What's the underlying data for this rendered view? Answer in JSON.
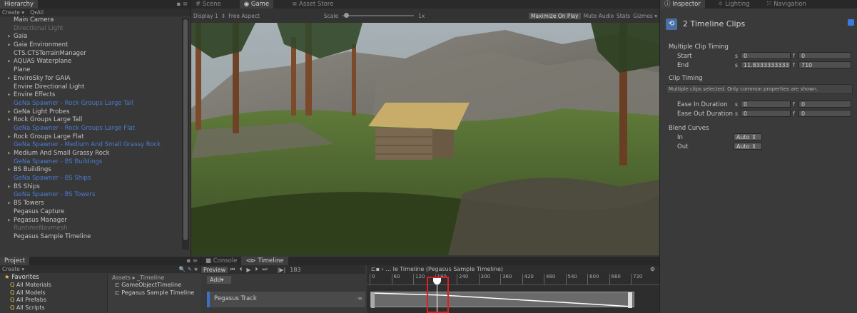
{
  "hierarchy": {
    "tab": "Hierarchy",
    "create": "Create ▾",
    "search": "Q▾All",
    "items": [
      {
        "label": "Main Camera",
        "style": ""
      },
      {
        "label": "Directional Light",
        "style": "disabled"
      },
      {
        "label": "Gaia",
        "style": "arrow"
      },
      {
        "label": "Gaia Environment",
        "style": "arrow"
      },
      {
        "label": "CTS.CTSTerrainManager",
        "style": ""
      },
      {
        "label": "AQUAS Waterplane",
        "style": "arrow"
      },
      {
        "label": "Plane",
        "style": ""
      },
      {
        "label": "EnviroSky for GAIA",
        "style": "arrow"
      },
      {
        "label": "Envire Directional Light",
        "style": ""
      },
      {
        "label": "Envire Effects",
        "style": "arrow"
      },
      {
        "label": "GeNa Spawner - Rock Groups Large Tall",
        "style": "blue"
      },
      {
        "label": "GeNa Light Probes",
        "style": "arrow"
      },
      {
        "label": "Rock Groups Large Tall",
        "style": "arrow"
      },
      {
        "label": "GeNa Spawner - Rock Groups Large Flat",
        "style": "blue"
      },
      {
        "label": "Rock Groups Large Flat",
        "style": "arrow"
      },
      {
        "label": "GeNa Spawner - Medium And Small Grassy Rock",
        "style": "blue"
      },
      {
        "label": "Medium And Small Grassy Rock",
        "style": "arrow"
      },
      {
        "label": "GeNa Spawner - BS Buildings",
        "style": "blue"
      },
      {
        "label": "BS Buildings",
        "style": "arrow"
      },
      {
        "label": "GeNa Spawner - BS Ships",
        "style": "blue"
      },
      {
        "label": "BS Ships",
        "style": "arrow"
      },
      {
        "label": "GeNa Spawner - BS Towers",
        "style": "blue"
      },
      {
        "label": "BS Towers",
        "style": "arrow"
      },
      {
        "label": "Pegasus Capture",
        "style": ""
      },
      {
        "label": "Pegasus Manager",
        "style": "arrow"
      },
      {
        "label": "RuntimeNavmesh",
        "style": "disabled"
      },
      {
        "label": "Pegasus Sample Timeline",
        "style": ""
      }
    ]
  },
  "scene": {
    "tabs": [
      "# Scene",
      "Game",
      "Asset Store"
    ],
    "display": "Display 1",
    "aspect": "Free Aspect",
    "scale_label": "Scale",
    "scale_value": "1x",
    "maximize": "Maximize On Play",
    "mute": "Mute Audio",
    "stats": "Stats",
    "gizmos": "Gizmos ▾"
  },
  "inspector": {
    "tabs": [
      "Inspector",
      "Lighting",
      "Navigation"
    ],
    "title": "2 Timeline Clips",
    "multiple_clip_timing": "Multiple Clip Timing",
    "start_label": "Start",
    "start_s": "0",
    "start_f": "0",
    "end_label": "End",
    "end_s": "11.8333333333",
    "end_f": "710",
    "clip_timing": "Clip Timing",
    "note": "Multiple clips selected. Only common properties are shown.",
    "ease_in": "Ease In Duration",
    "ease_in_s": "0",
    "ease_in_f": "0",
    "ease_out": "Ease Out Duration",
    "ease_out_s": "0",
    "ease_out_f": "0",
    "blend_curves": "Blend Curves",
    "in_label": "In",
    "in_value": "Auto",
    "out_label": "Out",
    "out_value": "Auto",
    "s_prefix": "s",
    "f_prefix": "f"
  },
  "project": {
    "tab": "Project",
    "create": "Create ▾",
    "favorites": "Favorites",
    "fav_items": [
      "All Materials",
      "All Models",
      "All Prefabs",
      "All Scripts"
    ],
    "breadcrumb": "Assets ▸ _Timeline",
    "files": [
      "GameObjectTimeline",
      "Pegasus Sample Timeline"
    ]
  },
  "timeline": {
    "tabs": [
      "Console",
      "Timeline"
    ],
    "preview": "Preview",
    "frame": "183",
    "title": "... le Timeline (Pegasus Sample Timeline)",
    "add": "Add▾",
    "track": "Pegasus Track",
    "ticks": [
      "0",
      "60",
      "120",
      "180",
      "240",
      "300",
      "360",
      "420",
      "480",
      "540",
      "600",
      "660",
      "720"
    ]
  },
  "colors": {
    "accent": "#4a7bd0",
    "highlight": "#e02020",
    "playhead": "#ffffff"
  }
}
